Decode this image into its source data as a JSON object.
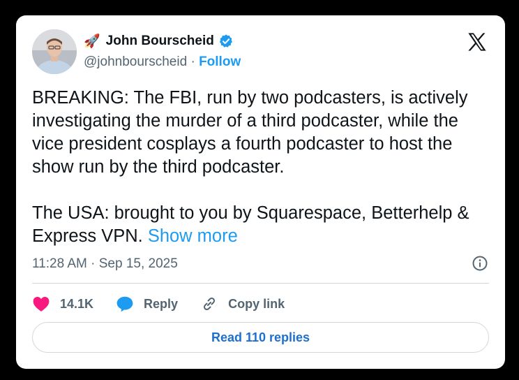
{
  "author": {
    "emoji": "🚀",
    "name": "John Bourscheid",
    "handle": "@johnbourscheid",
    "separator": "·",
    "follow_label": "Follow",
    "verified_color": "#1d9bf0"
  },
  "tweet": {
    "text": "BREAKING: The FBI, run by two podcasters, is actively investigating the murder of a third podcaster, while the vice president cosplays a fourth podcaster to host the show run by the third podcaster.\n\nThe USA: brought to you by Squarespace, Betterhelp & Express VPN. ",
    "show_more_label": "Show more",
    "timestamp": "11:28 AM · Sep 15, 2025"
  },
  "actions": {
    "likes_count": "14.1K",
    "reply_label": "Reply",
    "copy_link_label": "Copy link"
  },
  "read_replies_label": "Read 110 replies",
  "colors": {
    "accent": "#1d9bf0",
    "heart": "#f91880",
    "muted": "#536471"
  },
  "icons": [
    "rocket-emoji",
    "verified-badge-icon",
    "x-logo-icon",
    "info-icon",
    "heart-icon",
    "reply-bubble-icon",
    "link-icon"
  ]
}
